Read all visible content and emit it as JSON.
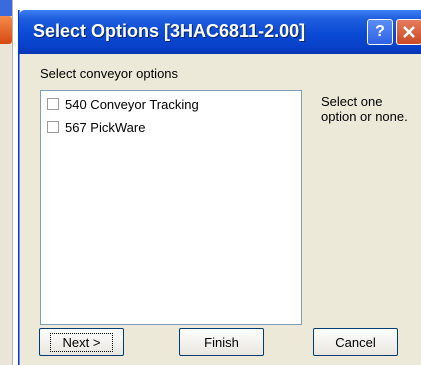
{
  "window": {
    "title": "Select Options [3HAC6811-2.00]",
    "help_button": "?",
    "close_icon": "close-icon"
  },
  "prompt": "Select conveyor options",
  "options": [
    {
      "label": "540 Conveyor Tracking",
      "checked": false
    },
    {
      "label": "567 PickWare",
      "checked": false
    }
  ],
  "help_text": "Select one option or none.",
  "buttons": {
    "next": "Next >",
    "finish": "Finish",
    "cancel": "Cancel"
  },
  "colors": {
    "titlebar": "#0a4ad4",
    "dialog_bg": "#ece9d8",
    "close_button": "#c94a26"
  }
}
